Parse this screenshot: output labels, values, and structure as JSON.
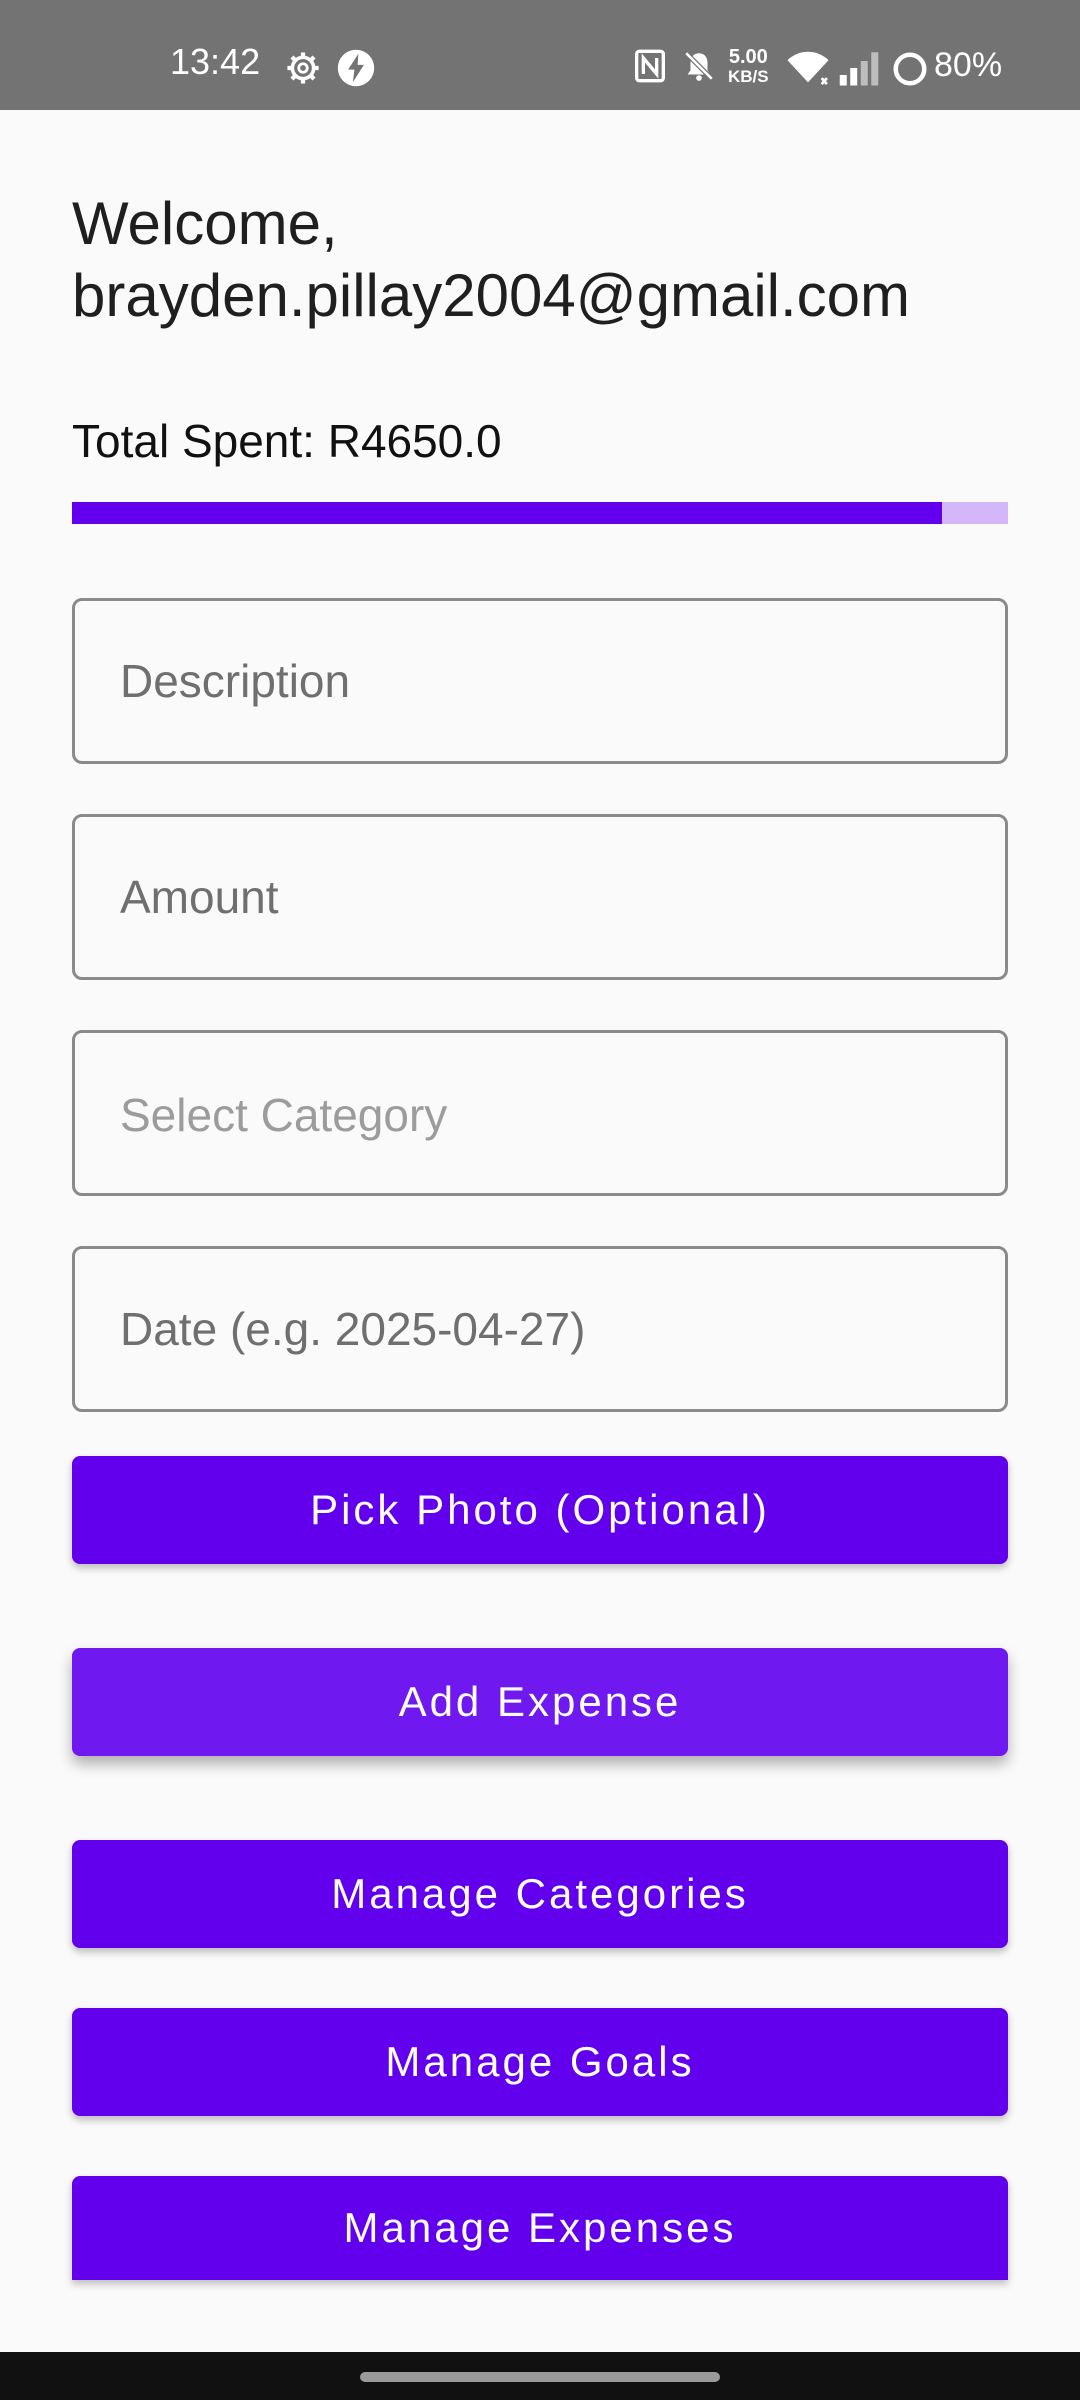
{
  "status_bar": {
    "time": "13:42",
    "net_speed_value": "5.00",
    "net_speed_unit": "KB/S",
    "battery": "80%",
    "icons": [
      "gear-icon",
      "flash-icon",
      "nfc-icon",
      "bell-muted-icon",
      "wifi-icon",
      "signal-icon",
      "battery-icon"
    ]
  },
  "header": {
    "welcome_line1": "Welcome,",
    "welcome_line2": "brayden.pillay2004@gmail.com"
  },
  "summary": {
    "total_spent": "Total Spent: R4650.0",
    "progress_fraction": 0.93,
    "progress_color": "#6200ee",
    "track_color": "#d4b7f8"
  },
  "form": {
    "description_placeholder": "Description",
    "amount_placeholder": "Amount",
    "category_placeholder": "Select Category",
    "date_placeholder": "Date (e.g. 2025-04-27)"
  },
  "buttons": {
    "pick_photo": "Pick Photo (Optional)",
    "add_expense": "Add Expense",
    "manage_categories": "Manage Categories",
    "manage_goals": "Manage Goals",
    "manage_expenses": "Manage Expenses"
  },
  "colors": {
    "accent": "#6200ee",
    "status_bar": "#737373",
    "background": "#fafafa"
  }
}
